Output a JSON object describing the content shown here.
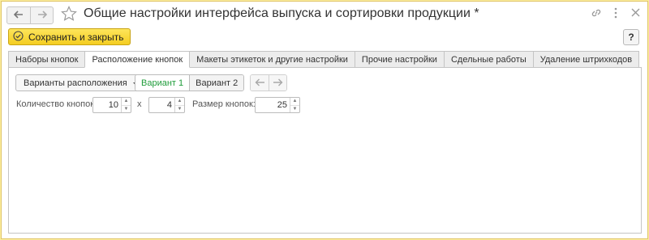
{
  "window": {
    "title": "Общие настройки интерфейса выпуска и сортировки продукции *",
    "icons": [
      "arrow-left-icon",
      "arrow-right-icon",
      "star-icon",
      "link-icon",
      "more-icon",
      "close-icon"
    ]
  },
  "toolbar": {
    "save_label": "Сохранить и закрыть",
    "help_label": "?"
  },
  "tabs": [
    {
      "label": "Наборы кнопок",
      "active": false
    },
    {
      "label": "Расположение кнопок",
      "active": true
    },
    {
      "label": "Макеты этикеток и другие настройки",
      "active": false
    },
    {
      "label": "Прочие настройки",
      "active": false
    },
    {
      "label": "Сдельные работы",
      "active": false
    },
    {
      "label": "Удаление штрихкодов",
      "active": false
    }
  ],
  "layout_panel": {
    "variants_dropdown_label": "Варианты расположения",
    "variants": [
      {
        "label": "Вариант 1",
        "selected": true
      },
      {
        "label": "Вариант 2",
        "selected": false
      }
    ],
    "buttons_count_label": "Количество кнопок:",
    "buttons_cols": "10",
    "multiply_sign": "x",
    "buttons_rows": "4",
    "button_size_label": "Размер кнопок:",
    "button_size": "25"
  },
  "colors": {
    "accent_yellow": "#f4cd21",
    "selected_variant_text": "#1f9c3a",
    "frame_border": "#e0c568"
  }
}
